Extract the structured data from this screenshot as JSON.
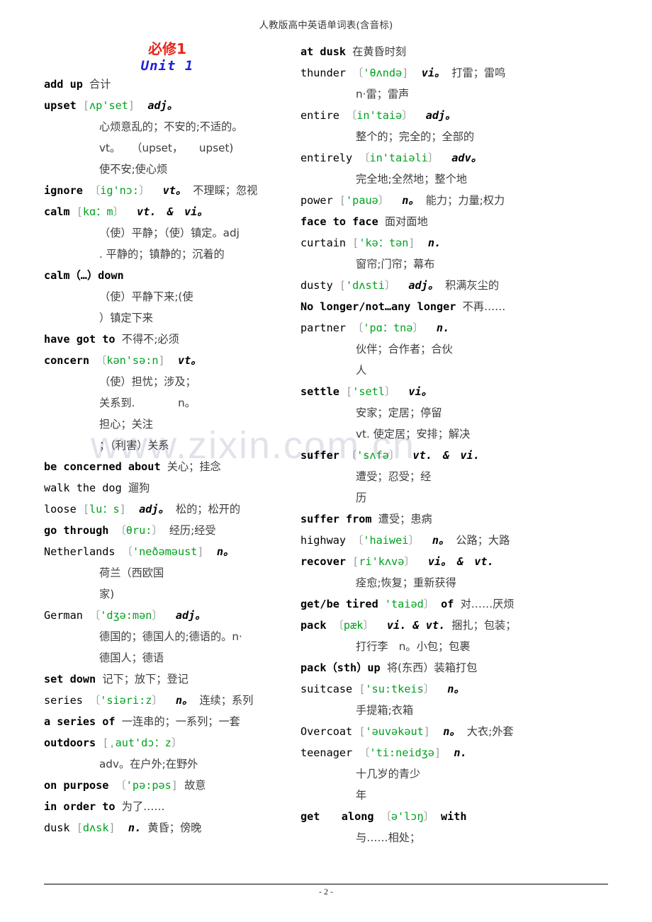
{
  "header": {
    "title": "人教版高中英语单词表(含音标)"
  },
  "watermark": {
    "text": "www.zixin.com.cn"
  },
  "footer": {
    "page_number": "- 2 -"
  },
  "left_column": {
    "book_title": "必修1",
    "unit_title": "Unit 1",
    "entries": [
      {
        "word": "add up",
        "bold": true,
        "chinese": "合计"
      },
      {
        "word": "upset",
        "bold": true,
        "phonetic": "[ʌp'set]",
        "pos": "adj。",
        "defs": [
          "心烦意乱的；不安的;不适的。",
          "vt。　　（upset，　　upset)",
          "使不安;使心烦"
        ]
      },
      {
        "word": "ignore",
        "bold": true,
        "phonetic": "〔ig'nɔ:〕",
        "pos": "vt。",
        "chinese": "不理睬；忽视"
      },
      {
        "word": "calm",
        "bold": true,
        "phonetic": "[kɑ：m〕",
        "pos": "vt.　&　vi。",
        "defs": [
          "（使）平静；（使）镇定。adj",
          ". 平静的；镇静的；沉着的"
        ]
      },
      {
        "word": "calm（…）down",
        "bold": true,
        "defs": [
          "（使）平静下来;(使",
          "）镇定下来"
        ]
      },
      {
        "word": "have got to",
        "bold": true,
        "chinese": "不得不;必须"
      },
      {
        "word": "concern",
        "bold": true,
        "phonetic": "〔kən'sə:n]",
        "pos": "vt。",
        "defs": [
          "（使）担忧；涉及；",
          "关系到.　　　　n。",
          "担心；关注",
          "；（利害）关系"
        ]
      },
      {
        "word": "be concerned about",
        "bold": true,
        "chinese": "关心；挂念"
      },
      {
        "word": "walk the dog",
        "bold": false,
        "chinese": "遛狗"
      },
      {
        "word": "loose",
        "bold": false,
        "phonetic": "[lu：s]",
        "pos": "adj。",
        "chinese": "松的；松开的"
      },
      {
        "word": "go through",
        "bold": true,
        "phonetic": "〔θru:〕",
        "chinese": "经历;经受"
      },
      {
        "word": "Netherlands",
        "bold": false,
        "phonetic": "〔'neðəməust]",
        "pos": "n。",
        "defs": [
          "荷兰（西欧国",
          "家)"
        ]
      },
      {
        "word": "German",
        "bold": false,
        "phonetic": "〔'dʒə:mən〕",
        "pos": "adj。",
        "defs": [
          "德国的；德国人的;德语的。n·",
          "德国人；德语"
        ]
      },
      {
        "word": "set down",
        "bold": true,
        "chinese": "记下；放下；登记"
      },
      {
        "word": "series",
        "bold": false,
        "phonetic": "〔'siəri:z〕",
        "pos": "n。",
        "chinese": "连续；系列"
      },
      {
        "word": "a series of",
        "bold": true,
        "chinese": "一连串的；一系列；一套"
      },
      {
        "word": "outdoors",
        "bold": true,
        "phonetic": "[ˌaut'dɔ：z〕",
        "defs": [
          "adv。在户外;在野外"
        ]
      },
      {
        "word": "on purpose",
        "bold": true,
        "phonetic": "〔'pə:pəs]",
        "chinese": "故意"
      },
      {
        "word": "in order to",
        "bold": true,
        "chinese": "为了……"
      },
      {
        "word": "dusk",
        "bold": false,
        "phonetic": "[dʌsk]",
        "pos": "n.",
        "chinese": "黄昏；傍晚"
      }
    ]
  },
  "right_column": {
    "entries": [
      {
        "word": "at dusk",
        "bold": true,
        "chinese": "在黄昏时刻"
      },
      {
        "word": "thunder",
        "bold": false,
        "phonetic": "〔'θʌndə]",
        "pos": "vi。",
        "chinese": "打雷；雷鸣",
        "defs": [
          "n·雷；雷声"
        ]
      },
      {
        "word": "entire",
        "bold": false,
        "phonetic": "〔in'taiə〕",
        "pos": "adj。",
        "defs": [
          "整个的；完全的；全部的"
        ]
      },
      {
        "word": "entirely",
        "bold": false,
        "phonetic": "〔in'taiəli〕",
        "pos": "adv。",
        "defs": [
          "完全地;全然地；整个地"
        ]
      },
      {
        "word": "power",
        "bold": false,
        "phonetic": "['pauə〕",
        "pos": "n。",
        "chinese": "能力；力量;权力"
      },
      {
        "word": "face to face",
        "bold": true,
        "chinese": "面对面地"
      },
      {
        "word": "curtain",
        "bold": false,
        "phonetic": "['kə：tən]",
        "pos": "n.",
        "defs": [
          "窗帘;门帘；幕布"
        ]
      },
      {
        "word": "dusty",
        "bold": false,
        "phonetic": "['dʌsti〕",
        "pos": "adj。",
        "chinese": "积满灰尘的"
      },
      {
        "word": "No longer/not…any longer",
        "bold": true,
        "chinese": "不再……"
      },
      {
        "word": "partner",
        "bold": false,
        "phonetic": "〔'pɑ：tnə〕",
        "pos": "n.",
        "defs": [
          "伙伴；合作者；合伙",
          "人"
        ]
      },
      {
        "word": "settle",
        "bold": true,
        "phonetic": "['setl〕",
        "pos": "vi。",
        "defs": [
          "安家；定居；停留",
          "vt. 使定居；安排；解决"
        ]
      },
      {
        "word": "suffer",
        "bold": true,
        "phonetic": "〔'sʌfə〕",
        "pos": "vt.　&　vi.",
        "defs": [
          "遭受；忍受；经",
          "历"
        ]
      },
      {
        "word": "suffer from",
        "bold": true,
        "chinese": "遭受；患病"
      },
      {
        "word": "highway",
        "bold": false,
        "phonetic": "〔'haiwei〕",
        "pos": "n。",
        "chinese": "公路；大路"
      },
      {
        "word": "recover",
        "bold": true,
        "phonetic": "[ri'kʌvə〕",
        "pos": "vi。　&　vt.",
        "defs": [
          "痊愈;恢复；重新获得"
        ]
      },
      {
        "word": "get/be tired",
        "bold": true,
        "phonetic": "'taiəd〕",
        "suffix": "of",
        "chinese": "对……厌烦"
      },
      {
        "word": "pack",
        "bold": true,
        "phonetic": "〔pæk〕",
        "pos": "vi. & vt.",
        "chinese": "捆扎；包装；",
        "defs": [
          "打行李　n。小包；包裹"
        ]
      },
      {
        "word": "pack（sth）up",
        "bold": true,
        "chinese": "将(东西）装箱打包"
      },
      {
        "word": "suitcase",
        "bold": false,
        "phonetic": "['su:tkeis〕",
        "pos": "n。",
        "defs": [
          "手提箱;衣箱"
        ]
      },
      {
        "word": "Overcoat",
        "bold": false,
        "phonetic": "['əuvəkəut]",
        "pos": "n。",
        "chinese": "大衣;外套"
      },
      {
        "word": "teenager",
        "bold": false,
        "phonetic": "〔'ti:neidʒə]",
        "pos": "n.",
        "defs": [
          "十几岁的青少",
          "年"
        ]
      },
      {
        "word": "get　　along",
        "bold": true,
        "phonetic": "〔ə'lɔŋ〕",
        "suffix": "with",
        "defs": [
          "与……相处；"
        ]
      }
    ]
  },
  "colors": {
    "book_title": "#e8241b",
    "unit_title": "#2020e0",
    "phonetic": "#00a11e",
    "chinese": "#3d3d3d",
    "watermark": "#dcdfe8"
  }
}
